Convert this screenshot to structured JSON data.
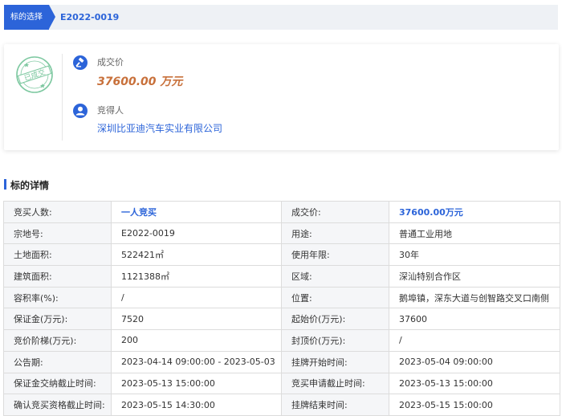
{
  "breadcrumb": {
    "tab": "标的选择",
    "code": "E2022-0019"
  },
  "stamp_text": "已成交",
  "result": {
    "price_label": "成交价",
    "price_value": "37600.00 万元",
    "winner_label": "竞得人",
    "winner_value": "深圳比亚迪汽车实业有限公司"
  },
  "section_title": "标的详情",
  "details": [
    [
      "竞买人数:",
      "一人竞买",
      "成交价:",
      "37600.00万元"
    ],
    [
      "宗地号:",
      "E2022-0019",
      "用途:",
      "普通工业用地"
    ],
    [
      "土地面积:",
      "522421㎡",
      "使用年限:",
      "30年"
    ],
    [
      "建筑面积:",
      "1121388㎡",
      "区域:",
      "深汕特别合作区"
    ],
    [
      "容积率(%):",
      "/",
      "位置:",
      "鹅埠镇，深东大道与创智路交叉口南侧"
    ],
    [
      "保证金(万元):",
      "7520",
      "起始价(万元):",
      "37600"
    ],
    [
      "竞价阶梯(万元):",
      "200",
      "封顶价(万元):",
      "/"
    ],
    [
      "公告期:",
      "2023-04-14 09:00:00 - 2023-05-03",
      "挂牌开始时间:",
      "2023-05-04 09:00:00"
    ],
    [
      "保证金交纳截止时间:",
      "2023-05-13 15:00:00",
      "竞买申请截止时间:",
      "2023-05-13 15:00:00"
    ],
    [
      "确认竞买资格截止时间:",
      "2023-05-15 14:30:00",
      "挂牌结束时间:",
      "2023-05-15 15:00:00"
    ]
  ],
  "colors": {
    "accent": "#2c64d9",
    "price": "#c8703a",
    "stamp": "#7dc8a0"
  },
  "icons": {
    "price": "gavel-icon",
    "winner": "user-icon",
    "stamp": "sold-stamp-icon"
  }
}
